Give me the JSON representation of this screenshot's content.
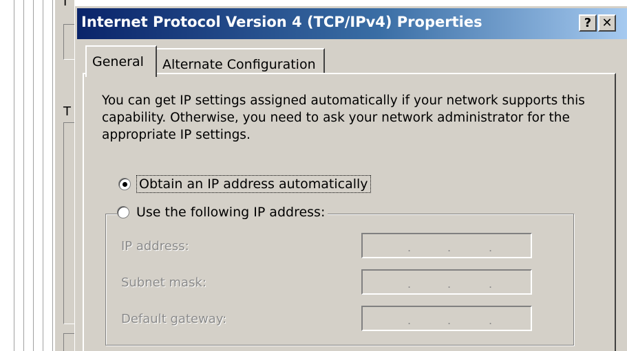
{
  "background": {
    "letters": [
      "I",
      "T"
    ]
  },
  "dialog": {
    "title": "Internet Protocol Version 4 (TCP/IPv4) Properties",
    "help_button": "?",
    "close_button": "✕",
    "tabs": [
      {
        "label": "General",
        "active": true
      },
      {
        "label": "Alternate Configuration",
        "active": false
      }
    ],
    "description": "You can get IP settings assigned automatically if your network supports this capability. Otherwise, you need to ask your network administrator for the appropriate IP settings.",
    "options": {
      "auto_ip_label": "Obtain an IP address automatically",
      "auto_ip_selected": true,
      "static_ip_label": "Use the following IP address:",
      "static_ip_selected": false
    },
    "fields": [
      {
        "label": "IP address:",
        "value": ". . ."
      },
      {
        "label": "Subnet mask:",
        "value": ". . ."
      },
      {
        "label": "Default gateway:",
        "value": ". . ."
      }
    ],
    "colors": {
      "titlebar_start": "#0a246a",
      "titlebar_end": "#a6caf0",
      "face": "#d4d0c8"
    }
  }
}
